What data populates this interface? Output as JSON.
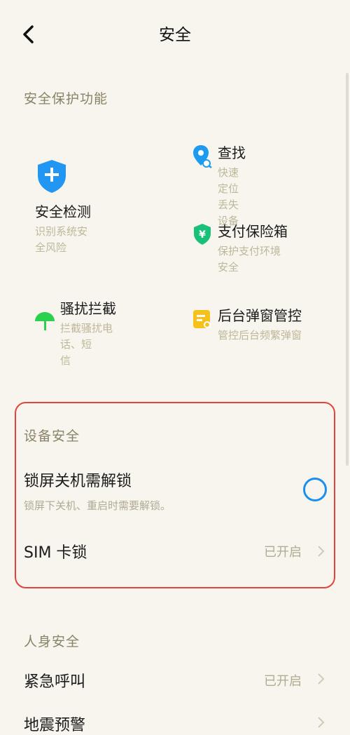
{
  "header": {
    "title": "安全",
    "back_icon": "back-arrow-icon"
  },
  "protection": {
    "section_title": "安全保护功能",
    "security_check": {
      "name": "安全检测",
      "desc": "识别系统安全风险",
      "icon": "shield-plus-icon",
      "color": "#2196f3"
    },
    "find": {
      "name": "查找",
      "desc": "快速定位丢失设备",
      "icon": "location-pin-icon",
      "color": "#1e9bf0"
    },
    "payment_safe": {
      "name": "支付保险箱",
      "desc": "保护支付环境安全",
      "icon": "yuan-shield-icon",
      "color": "#18c07a"
    },
    "harassment": {
      "name": "骚扰拦截",
      "desc_line1": "拦截骚扰电话、短",
      "desc_line2": "信",
      "icon": "umbrella-icon",
      "color": "#2bd04e"
    },
    "popup_control": {
      "name": "后台弹窗管控",
      "desc": "管控后台频繁弹窗",
      "icon": "popup-window-icon",
      "color": "#f7c11c"
    }
  },
  "device_security": {
    "section_title": "设备安全",
    "lock_shutdown": {
      "label": "锁屏关机需解锁",
      "sub": "锁屏下关机、重启时需要解锁。",
      "enabled": false
    },
    "sim_lock": {
      "label": "SIM 卡锁",
      "status": "已开启"
    }
  },
  "personal_safety": {
    "section_title": "人身安全",
    "emergency": {
      "label": "紧急呼叫",
      "status": "已开启"
    },
    "earthquake": {
      "label": "地震预警"
    }
  },
  "colors": {
    "accent": "#1a8ff0",
    "highlight_border": "#e0443c",
    "background": "#f7f5ee"
  }
}
